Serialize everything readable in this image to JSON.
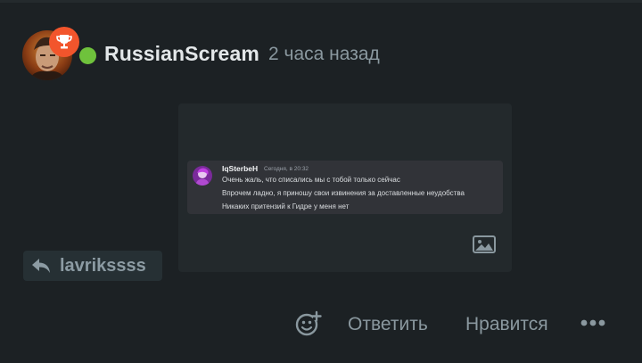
{
  "post": {
    "username": "RussianScream",
    "timestamp": "2 часа назад",
    "author_status": "online",
    "badge_icon": "trophy-icon",
    "colors": {
      "online": "#6fc23c",
      "badge": "#f2552c"
    }
  },
  "embed": {
    "message": {
      "author": "IqSterbeH",
      "time": "Сегодня, в 20:32",
      "lines": [
        "Очень жаль, что списались мы с тобой только сейчас",
        "Впрочем ладно, я приношу свои извинения за доставленные неудобства",
        "Никаких притензий к Гидре у меня нет"
      ]
    },
    "icon": "image-icon"
  },
  "reply_to": {
    "label": "lavrikssss",
    "icon": "reply-arrow-icon"
  },
  "actions": {
    "reply_label": "Ответить",
    "like_label": "Нравится",
    "react_icon": "add-reaction-icon",
    "more_icon": "more-icon"
  }
}
